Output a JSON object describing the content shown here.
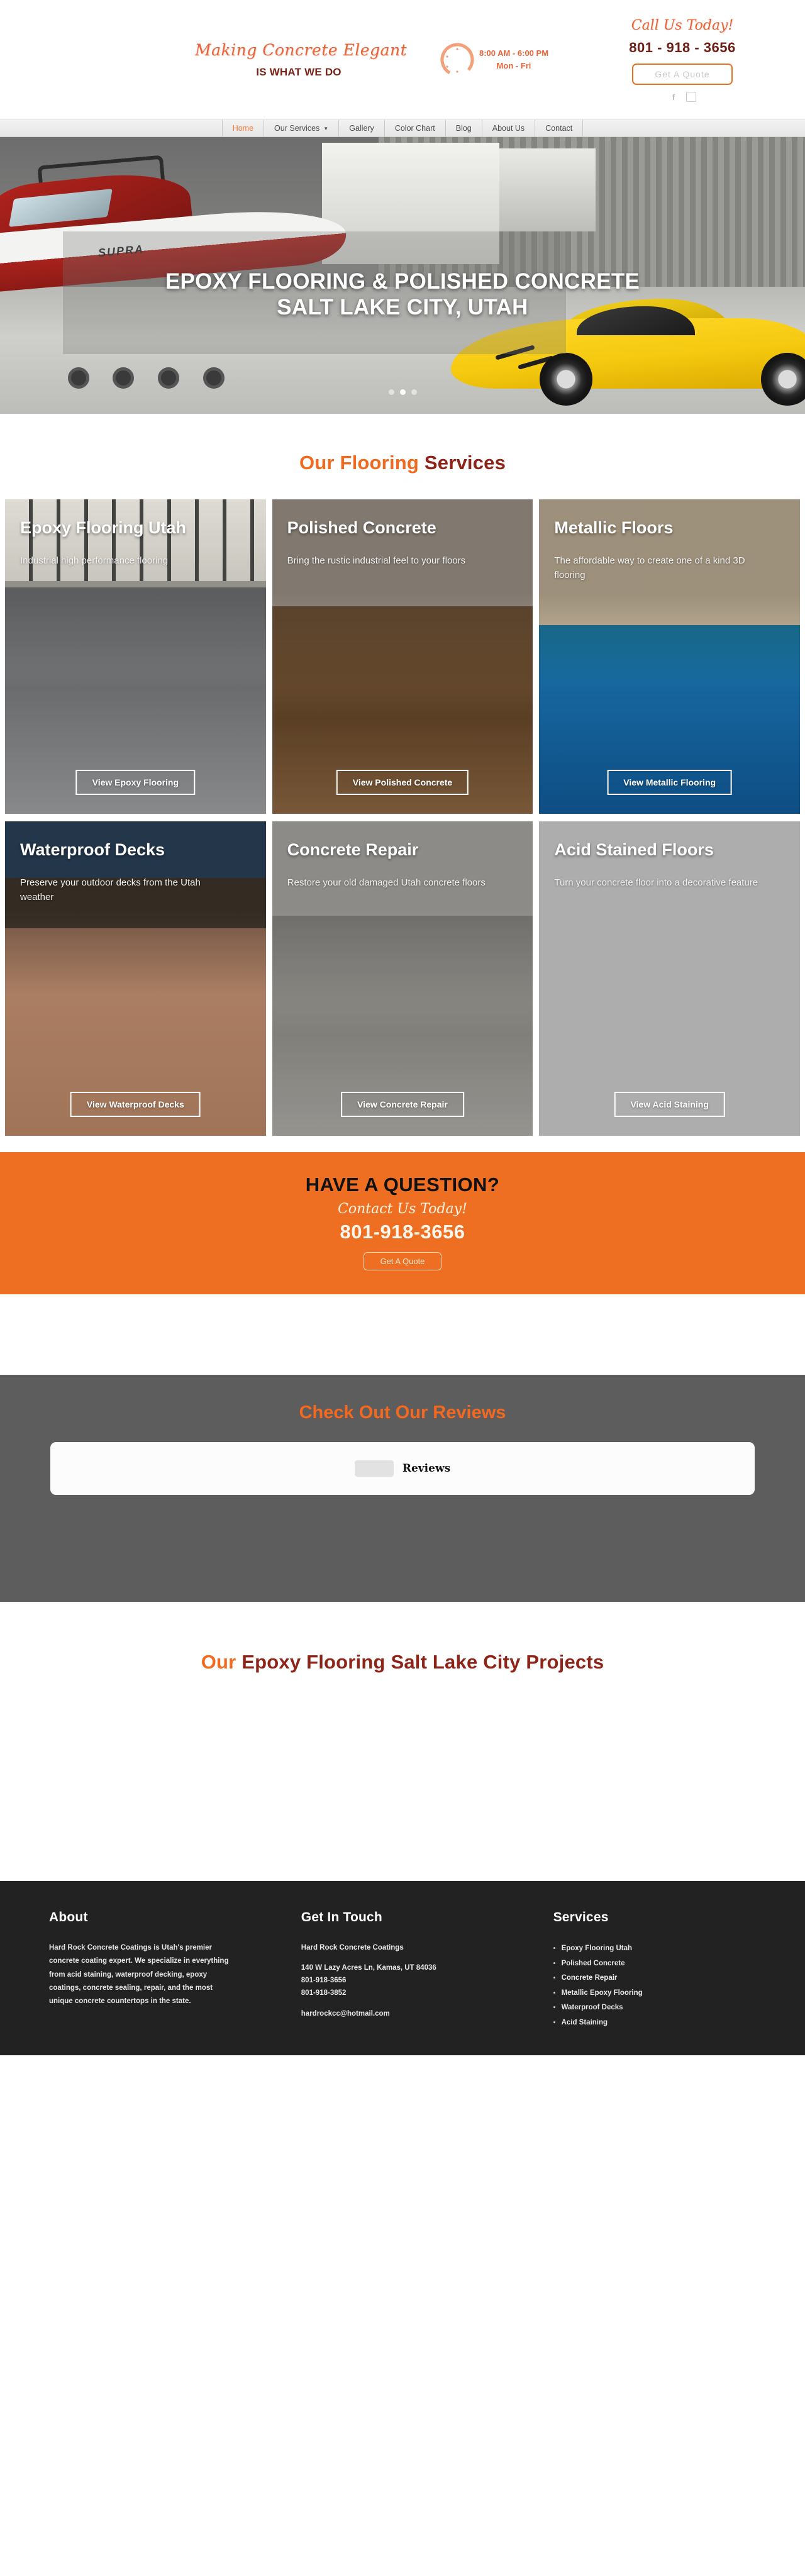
{
  "header": {
    "tagline_script": "Making Concrete Elegant",
    "tagline_bold": "IS WHAT WE DO",
    "hours_line1": "8:00 AM - 6:00 PM",
    "hours_line2": "Mon - Fri",
    "call_script": "Call Us Today!",
    "phone": "801 - 918 - 3656",
    "quote_label": "Get A Quote",
    "social_facebook": "f",
    "social_instagram": "□"
  },
  "nav": {
    "items": [
      {
        "label": "Home",
        "active": true,
        "caret": false
      },
      {
        "label": "Our Services",
        "active": false,
        "caret": true
      },
      {
        "label": "Gallery",
        "active": false,
        "caret": false
      },
      {
        "label": "Color Chart",
        "active": false,
        "caret": false
      },
      {
        "label": "Blog",
        "active": false,
        "caret": false
      },
      {
        "label": "About Us",
        "active": false,
        "caret": false
      },
      {
        "label": "Contact",
        "active": false,
        "caret": false
      }
    ]
  },
  "hero": {
    "title_line1": "EPOXY FLOORING & POLISHED CONCRETE",
    "title_line2": "SALT LAKE CITY, UTAH",
    "boat_brand": "SUPRA",
    "slides": 3,
    "active_slide": 1
  },
  "services_section": {
    "title_orange": "Our Flooring",
    "title_dark": "Services",
    "cards": [
      {
        "title": "Epoxy Flooring Utah",
        "desc": "Industrial high performance flooring",
        "button": "View Epoxy Flooring",
        "bg": "bg-epoxy"
      },
      {
        "title": "Polished Concrete",
        "desc": "Bring the rustic industrial feel to your floors",
        "button": "View Polished Concrete",
        "bg": "bg-polished"
      },
      {
        "title": "Metallic Floors",
        "desc": "The affordable way to create one of a kind 3D flooring",
        "button": "View Metallic Flooring",
        "bg": "bg-metallic"
      },
      {
        "title": "Waterproof Decks",
        "desc": "Preserve your outdoor decks from the Utah weather",
        "button": "View Waterproof Decks",
        "bg": "bg-deck"
      },
      {
        "title": "Concrete Repair",
        "desc": "Restore your old damaged Utah concrete floors",
        "button": "View Concrete Repair",
        "bg": "bg-repair"
      },
      {
        "title": "Acid Stained Floors",
        "desc": "Turn your concrete floor into a decorative feature",
        "button": "View Acid Staining",
        "bg": "bg-acid"
      }
    ]
  },
  "cta": {
    "heading": "HAVE A QUESTION?",
    "script": "Contact Us Today!",
    "phone": "801-918-3656",
    "button": "Get A Quote",
    "bg_color": "#ee6f22"
  },
  "reviews": {
    "title": "Check Out Our Reviews",
    "widget_label": "Reviews",
    "bg_color": "#5d5d5d"
  },
  "projects": {
    "title_orange": "Our",
    "title_dark": "Epoxy Flooring Salt Lake City Projects"
  },
  "footer": {
    "about": {
      "heading": "About",
      "text": "Hard Rock Concrete Coatings is Utah's premier concrete coating expert. We specialize in everything from acid staining, waterproof decking, epoxy coatings, concrete sealing, repair, and the most unique concrete countertops in the state."
    },
    "contact": {
      "heading": "Get In Touch",
      "company": "Hard Rock Concrete Coatings",
      "address": "140 W Lazy Acres Ln, Kamas, UT 84036",
      "phone1": "801-918-3656",
      "phone2": "801-918-3852",
      "email": "hardrockcc@hotmail.com"
    },
    "services": {
      "heading": "Services",
      "items": [
        "Epoxy Flooring Utah",
        "Polished Concrete",
        "Concrete Repair",
        "Metallic Epoxy Flooring",
        "Waterproof Decks",
        "Acid Staining"
      ]
    }
  }
}
